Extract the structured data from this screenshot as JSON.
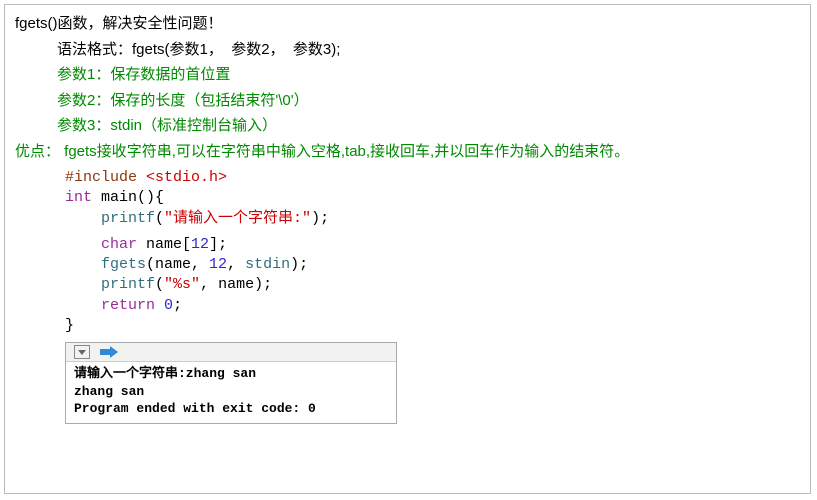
{
  "title": "fgets()函数，解决安全性问题！",
  "syntax": "语法格式：fgets(参数1，  参数2，  参数3);",
  "param1": "参数1：保存数据的首位置",
  "param2": "参数2：保存的长度（包括结束符'\\0'）",
  "param3": "参数3：stdin（标准控制台输入）",
  "advantage": "优点： fgets接收字符串,可以在字符串中输入空格,tab,接收回车,并以回车作为输入的结束符。",
  "code": {
    "include_kw": "#include ",
    "include_hdr": "<stdio.h>",
    "int": "int",
    "main_sig": " main(){",
    "printf1_fn": "printf",
    "printf1_open": "(",
    "printf1_str": "\"请输入一个字符串:\"",
    "printf1_close": ");",
    "char_kw": "char",
    "name_decl_a": " name[",
    "name_decl_n": "12",
    "name_decl_b": "];",
    "fgets_fn": "fgets",
    "fgets_a": "(name, ",
    "fgets_n": "12",
    "fgets_b": ", ",
    "fgets_stdin": "stdin",
    "fgets_c": ");",
    "printf2_fn": "printf",
    "printf2_a": "(",
    "printf2_str": "\"%s\"",
    "printf2_b": ", name);",
    "return_kw": "return",
    "return_sp": " ",
    "return_n": "0",
    "return_semi": ";",
    "brace": "}"
  },
  "console": {
    "line1": "请输入一个字符串:zhang san",
    "line2": "zhang san",
    "line3": "Program ended with exit code: 0"
  }
}
